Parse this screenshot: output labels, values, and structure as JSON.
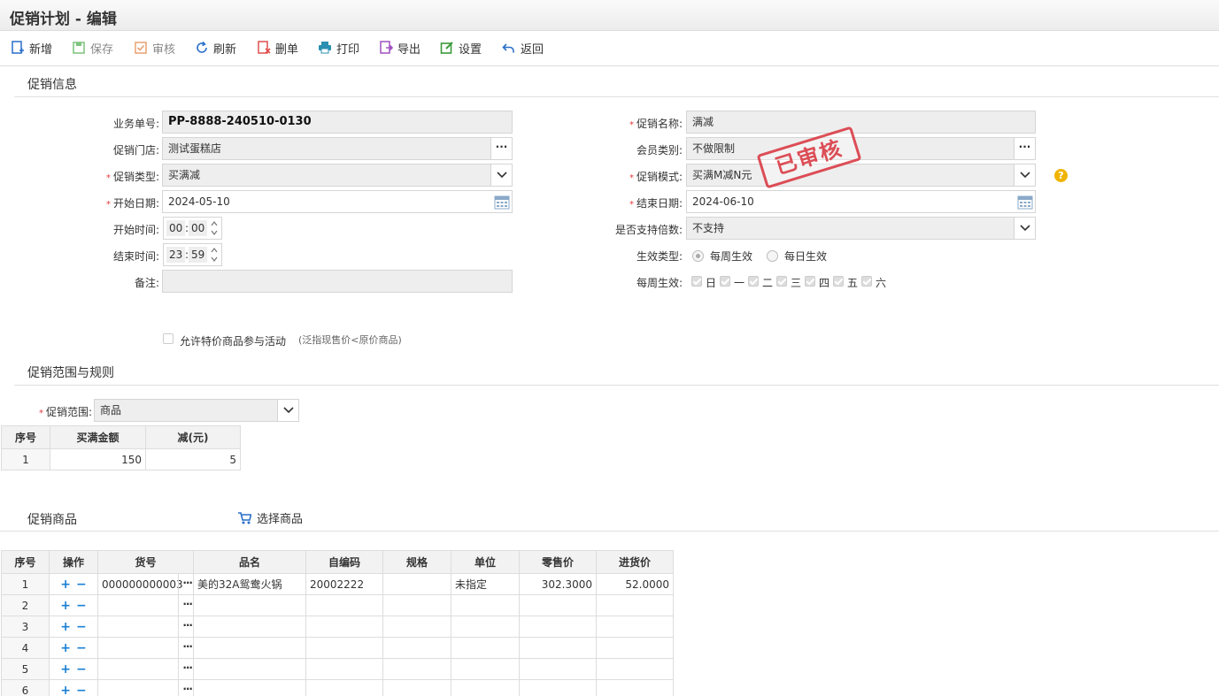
{
  "window": {
    "title": "促销计划 - 编辑"
  },
  "toolbar": {
    "new": "新增",
    "save": "保存",
    "audit": "审核",
    "refresh": "刷新",
    "delete": "删单",
    "print": "打印",
    "export": "导出",
    "settings": "设置",
    "back": "返回"
  },
  "sections": {
    "info": "促销信息",
    "scope": "促销范围与规则",
    "goods": "促销商品"
  },
  "form": {
    "order_no_label": "业务单号:",
    "order_no": "PP-8888-240510-0130",
    "store_label": "促销门店:",
    "store": "测试蛋糕店",
    "type_label": "促销类型:",
    "type": "买满减",
    "start_date_label": "开始日期:",
    "start_date": "2024-05-10",
    "start_time_label": "开始时间:",
    "start_hour": "00",
    "start_minute": "00",
    "end_time_label": "结束时间:",
    "end_hour": "23",
    "end_minute": "59",
    "note_label": "备注:",
    "note": "",
    "name_label": "促销名称:",
    "name": "满减",
    "member_label": "会员类别:",
    "member": "不做限制",
    "mode_label": "促销模式:",
    "mode": "买满M减N元",
    "end_date_label": "结束日期:",
    "end_date": "2024-06-10",
    "multiple_label": "是否支持倍数:",
    "multiple": "不支持",
    "effect_type_label": "生效类型:",
    "effect_weekly": "每周生效",
    "effect_daily": "每日生效",
    "weekly_label": "每周生效:",
    "weekdays": [
      "日",
      "一",
      "二",
      "三",
      "四",
      "五",
      "六"
    ],
    "special_price_label": "允许特价商品参与活动",
    "special_price_hint": "(泛指现售价<原价商品)",
    "stamp": "已审核",
    "help": "?"
  },
  "scope": {
    "label": "促销范围:",
    "value": "商品"
  },
  "rules_table": {
    "headers": [
      "序号",
      "买满金额",
      "减(元)"
    ],
    "rows": [
      [
        "1",
        "150",
        "5"
      ]
    ]
  },
  "goods": {
    "pick_label": "选择商品",
    "headers": [
      "序号",
      "操作",
      "货号",
      "品名",
      "自编码",
      "规格",
      "单位",
      "零售价",
      "进货价"
    ],
    "rows": [
      [
        "1",
        "000000000003",
        "美的32A鸳鸯火锅",
        "20002222",
        "",
        "未指定",
        "302.3000",
        "52.0000"
      ],
      [
        "2",
        "",
        "",
        "",
        "",
        "",
        "",
        ""
      ],
      [
        "3",
        "",
        "",
        "",
        "",
        "",
        "",
        ""
      ],
      [
        "4",
        "",
        "",
        "",
        "",
        "",
        "",
        ""
      ],
      [
        "5",
        "",
        "",
        "",
        "",
        "",
        "",
        ""
      ],
      [
        "6",
        "",
        "",
        "",
        "",
        "",
        "",
        ""
      ]
    ],
    "op_plus": "+",
    "op_minus": "−",
    "dots": "···"
  }
}
